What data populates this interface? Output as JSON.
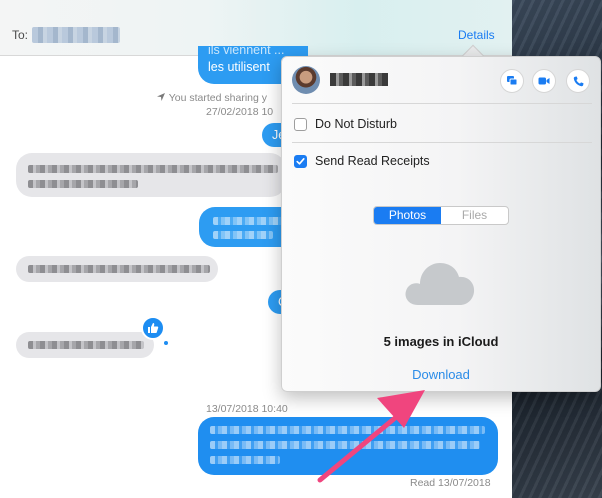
{
  "header": {
    "to_label": "To:",
    "details_label": "Details"
  },
  "conversation": {
    "partial_text_line1": "ils viennent ...",
    "partial_text_line2": "les utilisent",
    "location_notice": "You started sharing y",
    "timestamp_1": "27/02/2018 10",
    "partial_bubble_1": "Je",
    "partial_bubble_2": "C",
    "timestamp_2": "13/07/2018 10:40",
    "read_receipt": "Read 13/07/2018"
  },
  "details_popover": {
    "do_not_disturb_label": "Do Not Disturb",
    "do_not_disturb_checked": false,
    "read_receipts_label": "Send Read Receipts",
    "read_receipts_checked": true,
    "tabs": [
      {
        "label": "Photos",
        "active": true
      },
      {
        "label": "Files",
        "active": false
      }
    ],
    "icloud_count_label": "5 images in iCloud",
    "download_label": "Download"
  },
  "icons": {
    "screen_share": "screen-share-icon",
    "video": "video-camera-icon",
    "phone": "phone-icon",
    "location": "location-arrow-icon",
    "cloud": "cloud-icon",
    "like": "thumbs-up-icon"
  },
  "colors": {
    "accent": "#1a7cf2",
    "bubble_blue": "#2d9cf2",
    "bubble_grey": "#e6e6e9",
    "annotation_arrow": "#f0457e"
  }
}
